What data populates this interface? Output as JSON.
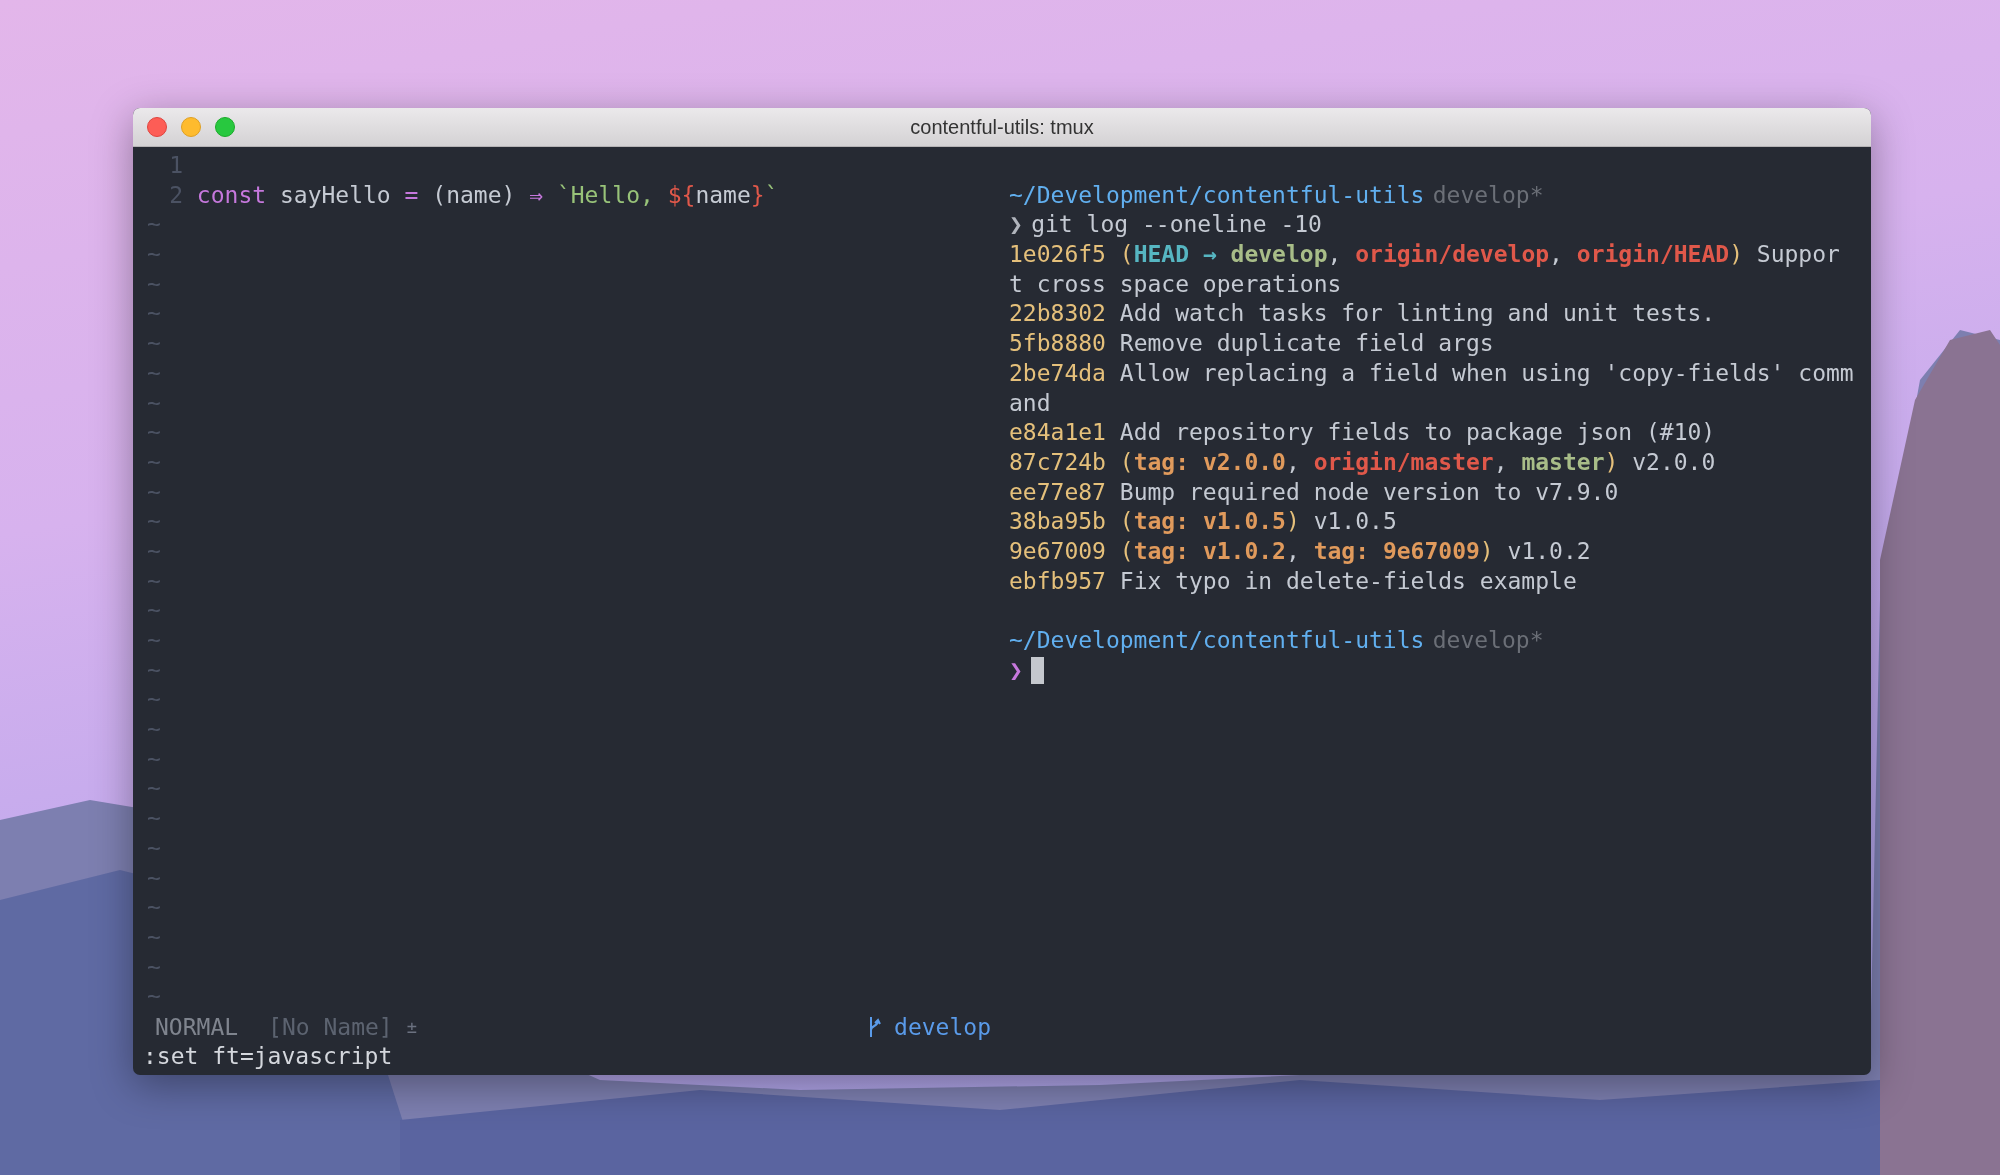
{
  "window": {
    "title": "contentful-utils: tmux"
  },
  "editor": {
    "lines": [
      {
        "number": "1"
      },
      {
        "number": "2",
        "segments": [
          {
            "kind": "keyword",
            "text": "const"
          },
          {
            "kind": "plain",
            "text": " sayHello "
          },
          {
            "kind": "operator",
            "text": "="
          },
          {
            "kind": "plain",
            "text": " (name) "
          },
          {
            "kind": "operator",
            "text": "⇒"
          },
          {
            "kind": "string",
            "text": " `Hello, "
          },
          {
            "kind": "interp",
            "text": "${"
          },
          {
            "kind": "plain",
            "text": "name"
          },
          {
            "kind": "interp",
            "text": "}"
          },
          {
            "kind": "string",
            "text": "`"
          }
        ]
      }
    ],
    "tildes": [
      "~",
      "~",
      "~",
      "~",
      "~",
      "~",
      "~",
      "~",
      "~",
      "~",
      "~",
      "~",
      "~",
      "~",
      "~",
      "~",
      "~",
      "~",
      "~",
      "~",
      "~",
      "~",
      "~",
      "~",
      "~",
      "~",
      "~"
    ],
    "statusline": {
      "mode": "NORMAL",
      "file": "[No Name]",
      "modified": "±",
      "branch": "develop"
    },
    "command_line": ":set ft=javascript"
  },
  "terminal": {
    "lines": [
      {
        "kind": "path",
        "path": "~/Development/contentful-utils",
        "branch": "develop*"
      },
      {
        "kind": "command",
        "prompt": "❯",
        "text": "git log --oneline -10",
        "active": false
      },
      {
        "kind": "log",
        "segments": [
          {
            "kind": "hash",
            "text": "1e026f5"
          },
          {
            "kind": "decor",
            "text": " ("
          },
          {
            "kind": "head",
            "text": "HEAD →"
          },
          {
            "kind": "local",
            "text": " develop"
          },
          {
            "kind": "plain",
            "text": ", "
          },
          {
            "kind": "remote",
            "text": "origin/develop"
          },
          {
            "kind": "plain",
            "text": ", "
          },
          {
            "kind": "remote",
            "text": "origin/HEAD"
          },
          {
            "kind": "decor",
            "text": ")"
          },
          {
            "kind": "plain",
            "text": " Suppor"
          }
        ]
      },
      {
        "kind": "log",
        "segments": [
          {
            "kind": "plain",
            "text": "t cross space operations"
          }
        ]
      },
      {
        "kind": "log",
        "segments": [
          {
            "kind": "hash",
            "text": "22b8302"
          },
          {
            "kind": "plain",
            "text": " Add watch tasks for linting and unit tests."
          }
        ]
      },
      {
        "kind": "log",
        "segments": [
          {
            "kind": "hash",
            "text": "5fb8880"
          },
          {
            "kind": "plain",
            "text": " Remove duplicate field args"
          }
        ]
      },
      {
        "kind": "log",
        "segments": [
          {
            "kind": "hash",
            "text": "2be74da"
          },
          {
            "kind": "plain",
            "text": " Allow replacing a field when using 'copy-fields' comm"
          }
        ]
      },
      {
        "kind": "log",
        "segments": [
          {
            "kind": "plain",
            "text": "and"
          }
        ]
      },
      {
        "kind": "log",
        "segments": [
          {
            "kind": "hash",
            "text": "e84a1e1"
          },
          {
            "kind": "plain",
            "text": " Add repository fields to package json (#10)"
          }
        ]
      },
      {
        "kind": "log",
        "segments": [
          {
            "kind": "hash",
            "text": "87c724b"
          },
          {
            "kind": "decor",
            "text": " ("
          },
          {
            "kind": "tag",
            "text": "tag: v2.0.0"
          },
          {
            "kind": "plain",
            "text": ", "
          },
          {
            "kind": "remote",
            "text": "origin/master"
          },
          {
            "kind": "plain",
            "text": ", "
          },
          {
            "kind": "local",
            "text": "master"
          },
          {
            "kind": "decor",
            "text": ")"
          },
          {
            "kind": "plain",
            "text": " v2.0.0"
          }
        ]
      },
      {
        "kind": "log",
        "segments": [
          {
            "kind": "hash",
            "text": "ee77e87"
          },
          {
            "kind": "plain",
            "text": " Bump required node version to v7.9.0"
          }
        ]
      },
      {
        "kind": "log",
        "segments": [
          {
            "kind": "hash",
            "text": "38ba95b"
          },
          {
            "kind": "decor",
            "text": " ("
          },
          {
            "kind": "tag",
            "text": "tag: v1.0.5"
          },
          {
            "kind": "decor",
            "text": ")"
          },
          {
            "kind": "plain",
            "text": " v1.0.5"
          }
        ]
      },
      {
        "kind": "log",
        "segments": [
          {
            "kind": "hash",
            "text": "9e67009"
          },
          {
            "kind": "decor",
            "text": " ("
          },
          {
            "kind": "tag",
            "text": "tag: v1.0.2"
          },
          {
            "kind": "plain",
            "text": ", "
          },
          {
            "kind": "tag",
            "text": "tag: 9e67009"
          },
          {
            "kind": "decor",
            "text": ")"
          },
          {
            "kind": "plain",
            "text": " v1.0.2"
          }
        ]
      },
      {
        "kind": "log",
        "segments": [
          {
            "kind": "hash",
            "text": "ebfb957"
          },
          {
            "kind": "plain",
            "text": " Fix typo in delete-fields example"
          }
        ]
      },
      {
        "kind": "blank"
      },
      {
        "kind": "path",
        "path": "~/Development/contentful-utils",
        "branch": "develop*"
      },
      {
        "kind": "command",
        "prompt": "❯",
        "active": true
      }
    ]
  }
}
